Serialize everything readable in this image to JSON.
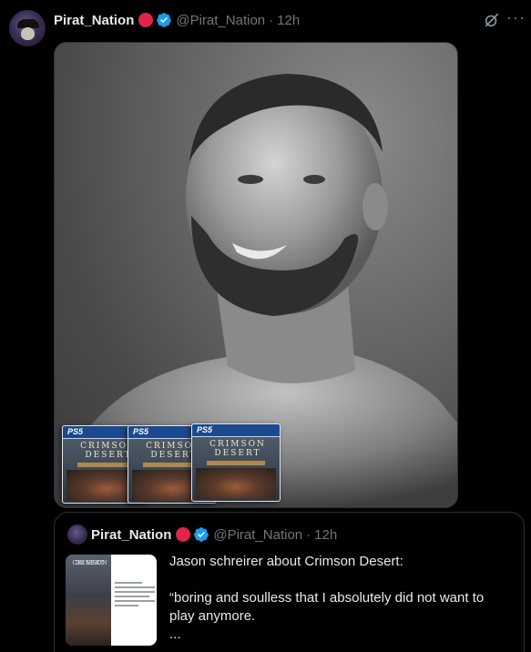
{
  "tweet": {
    "author_name": "Pirat_Nation",
    "author_handle": "@Pirat_Nation",
    "timestamp": "12h",
    "separator": "·",
    "more_glyph": "···"
  },
  "media": {
    "game_boxes": [
      {
        "platform": "PS5",
        "title_line1": "CRIMSON",
        "title_line2": "DESERT"
      },
      {
        "platform": "PS5",
        "title_line1": "CRIMSON",
        "title_line2": "DESERT"
      },
      {
        "platform": "PS5",
        "title_line1": "CRIMSON",
        "title_line2": "DESERT"
      }
    ]
  },
  "quoted": {
    "author_name": "Pirat_Nation",
    "author_handle": "@Pirat_Nation",
    "timestamp": "12h",
    "separator": "·",
    "thumbnail_cover_line1": "CRIMSON",
    "thumbnail_cover_line2": "DESERT",
    "text_line1": "Jason schreirer about Crimson Desert:",
    "text_line2": "“boring and soulless that I absolutely did not want to",
    "text_line3": "play anymore.",
    "text_line4": "..."
  },
  "colors": {
    "background": "#000000",
    "verified_blue": "#1d9bf0",
    "red_badge": "#e0244a",
    "muted_text": "#71767b"
  }
}
